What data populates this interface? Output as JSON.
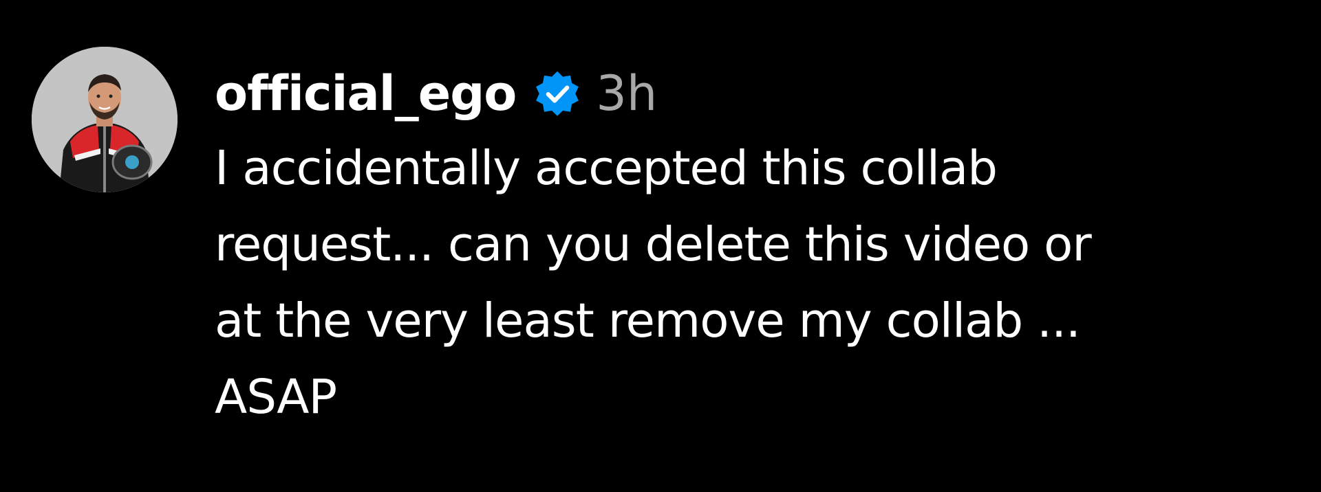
{
  "comment": {
    "avatar_icon": "profile-avatar-icon",
    "username": "official_ego",
    "verified_icon": "verified-badge-icon",
    "timestamp": "3h",
    "text": "I accidentally accepted this collab\nrequest... can you delete this video or\nat the very least remove my collab ...\nASAP"
  },
  "colors": {
    "background": "#000000",
    "text": "#ffffff",
    "timestamp": "#a8a8a8",
    "verified": "#0095f6"
  }
}
